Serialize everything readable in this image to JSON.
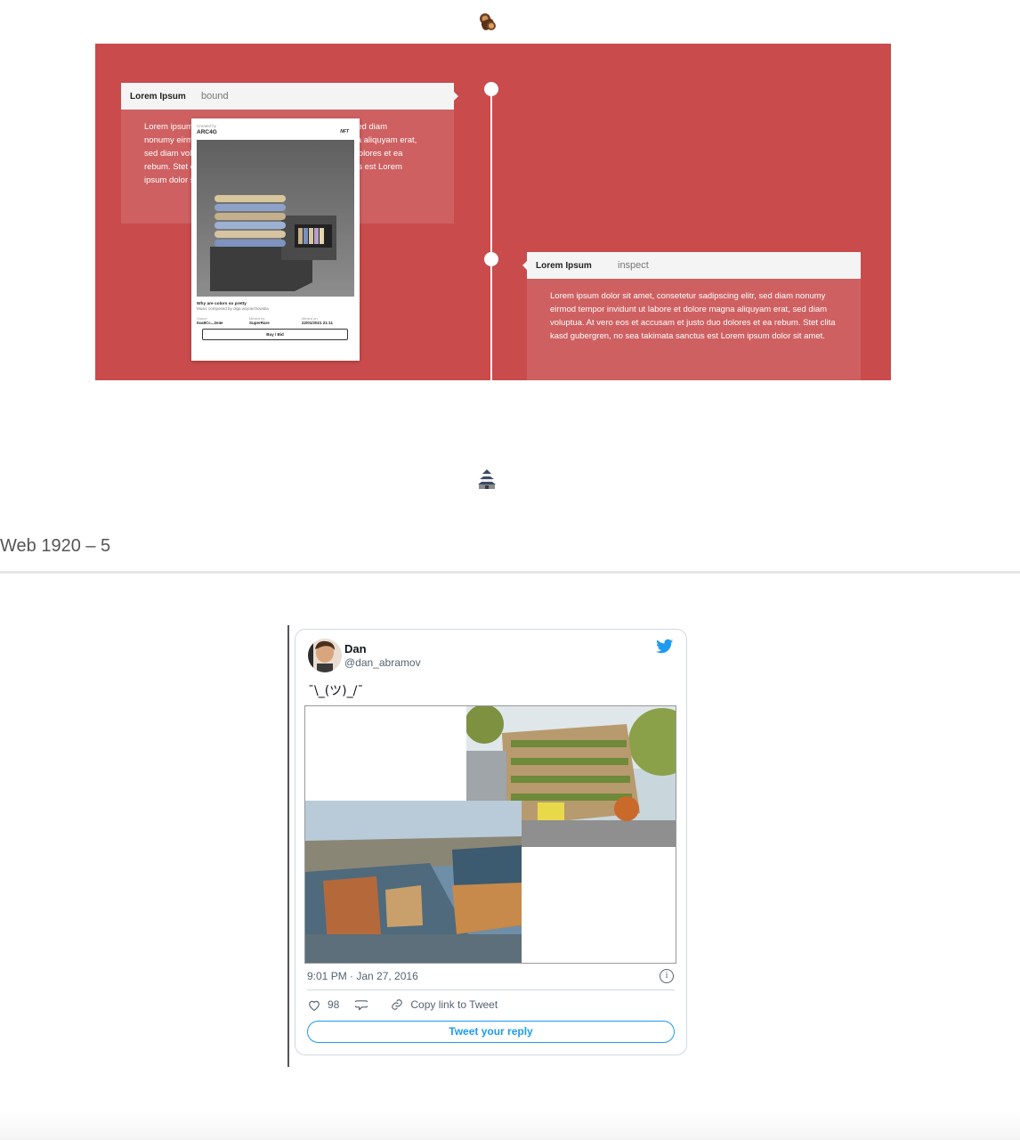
{
  "icons": {
    "top_emoji": "wood-log-icon",
    "middle_emoji": "japanese-castle-icon"
  },
  "timeline": {
    "accent": "#c94b4c",
    "card1": {
      "title": "Lorem Ipsum",
      "tag": "bound",
      "body": "Lorem ipsum dolor sit amet, consetetur sadipscing elitr, sed diam nonumy eirmod tempor invidunt ut labore et dolore magna aliquyam erat, sed diam voluptua. At vero eos et accusam et justo duo dolores et ea rebum. Stet clita kasd gubergren, no sea takimata sanctus est Lorem ipsum dolor sit amet."
    },
    "card2": {
      "title": "Lorem Ipsum",
      "tag": "inspect",
      "body": "Lorem ipsum dolor sit amet, consetetur sadipscing elitr, sed diam nonumy eirmod tempor invidunt ut labore et dolore magna aliquyam erat, sed diam voluptua. At vero eos et accusam et justo duo dolores et ea rebum. Stet clita kasd gubergren, no sea takimata sanctus est Lorem ipsum dolor sit amet."
    }
  },
  "nft": {
    "created_by_label": "Created by",
    "creator": "ARC4G",
    "badge": "NFT",
    "title": "Why are colors so pretty",
    "description": "Music composed by olga wojciechowska",
    "owner_label": "Owner",
    "owner": "0xa9Cc...2e4e",
    "minted_by_label": "Minted by",
    "minted_by": "SuperRare",
    "minted_on_label": "Minted on",
    "minted_on": "22/01/2021 21:11",
    "buy_label": "Buy / Bid"
  },
  "section_title": "Web 1920 – 5",
  "tweet": {
    "name": "Dan",
    "handle": "@dan_abramov",
    "text": "¯\\_(ツ)_/¯",
    "timestamp": "9:01 PM · Jan 27, 2016",
    "likes": "98",
    "copy_link_label": "Copy link to Tweet",
    "reply_label": "Tweet your reply",
    "brand_color": "#1d9bf0"
  }
}
